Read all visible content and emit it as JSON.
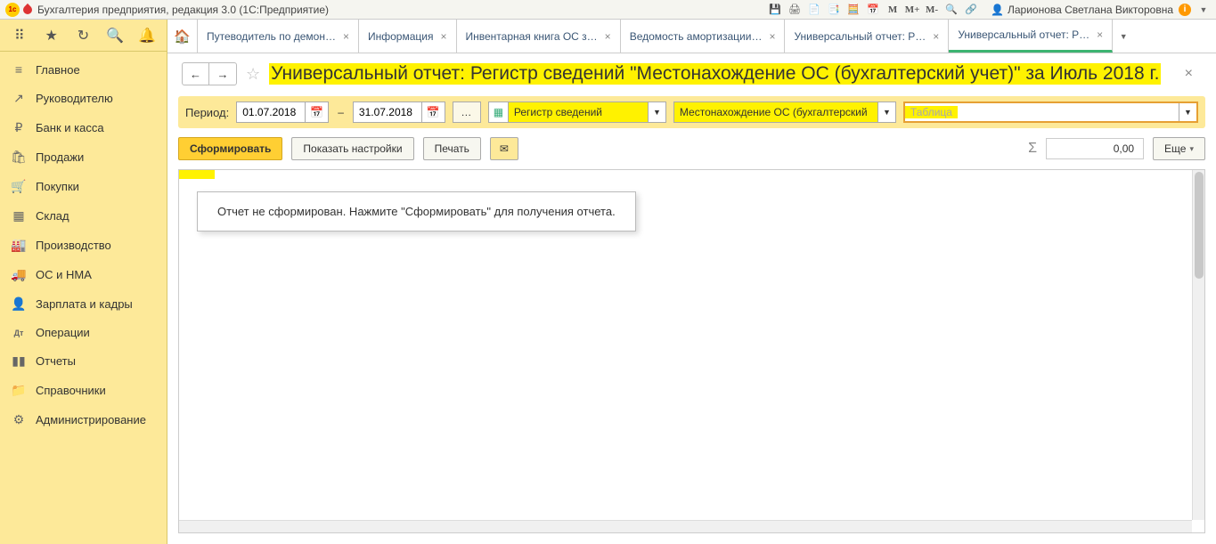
{
  "titlebar": {
    "title": "Бухгалтерия предприятия, редакция 3.0  (1С:Предприятие)",
    "user": "Ларионова Светлана Викторовна",
    "m1": "M",
    "m2": "M+",
    "m3": "M-"
  },
  "sidebar": {
    "items": [
      {
        "icon": "≡",
        "label": "Главное"
      },
      {
        "icon": "↗",
        "label": "Руководителю"
      },
      {
        "icon": "₽",
        "label": "Банк и касса"
      },
      {
        "icon": "🛍",
        "label": "Продажи"
      },
      {
        "icon": "🛒",
        "label": "Покупки"
      },
      {
        "icon": "▦",
        "label": "Склад"
      },
      {
        "icon": "🏭",
        "label": "Производство"
      },
      {
        "icon": "🚚",
        "label": "ОС и НМА"
      },
      {
        "icon": "👤",
        "label": "Зарплата и кадры"
      },
      {
        "icon": "Дт",
        "label": "Операции"
      },
      {
        "icon": "▮▮",
        "label": "Отчеты"
      },
      {
        "icon": "📁",
        "label": "Справочники"
      },
      {
        "icon": "⚙",
        "label": "Администрирование"
      }
    ]
  },
  "tabs": [
    {
      "label": "Путеводитель по демон…"
    },
    {
      "label": "Информация"
    },
    {
      "label": "Инвентарная книга ОС з…"
    },
    {
      "label": "Ведомость амортизации…"
    },
    {
      "label": "Универсальный отчет: Р…"
    },
    {
      "label": "Универсальный отчет: Р…",
      "active": true
    }
  ],
  "page": {
    "title": "Универсальный отчет: Регистр сведений \"Местонахождение ОС (бухгалтерский учет)\" за Июль 2018 г.",
    "close": "×"
  },
  "filters": {
    "period_label": "Период:",
    "date_from": "01.07.2018",
    "date_to": "31.07.2018",
    "dash": "–",
    "more": "…",
    "source_type": "Регистр сведений",
    "source_obj": "Местонахождение ОС (бухгалтерский",
    "table_placeholder": "Таблица"
  },
  "actions": {
    "generate": "Сформировать",
    "settings": "Показать настройки",
    "print": "Печать",
    "sum_value": "0,00",
    "more": "Еще"
  },
  "report": {
    "placeholder": "Отчет не сформирован. Нажмите \"Сформировать\" для получения отчета."
  }
}
